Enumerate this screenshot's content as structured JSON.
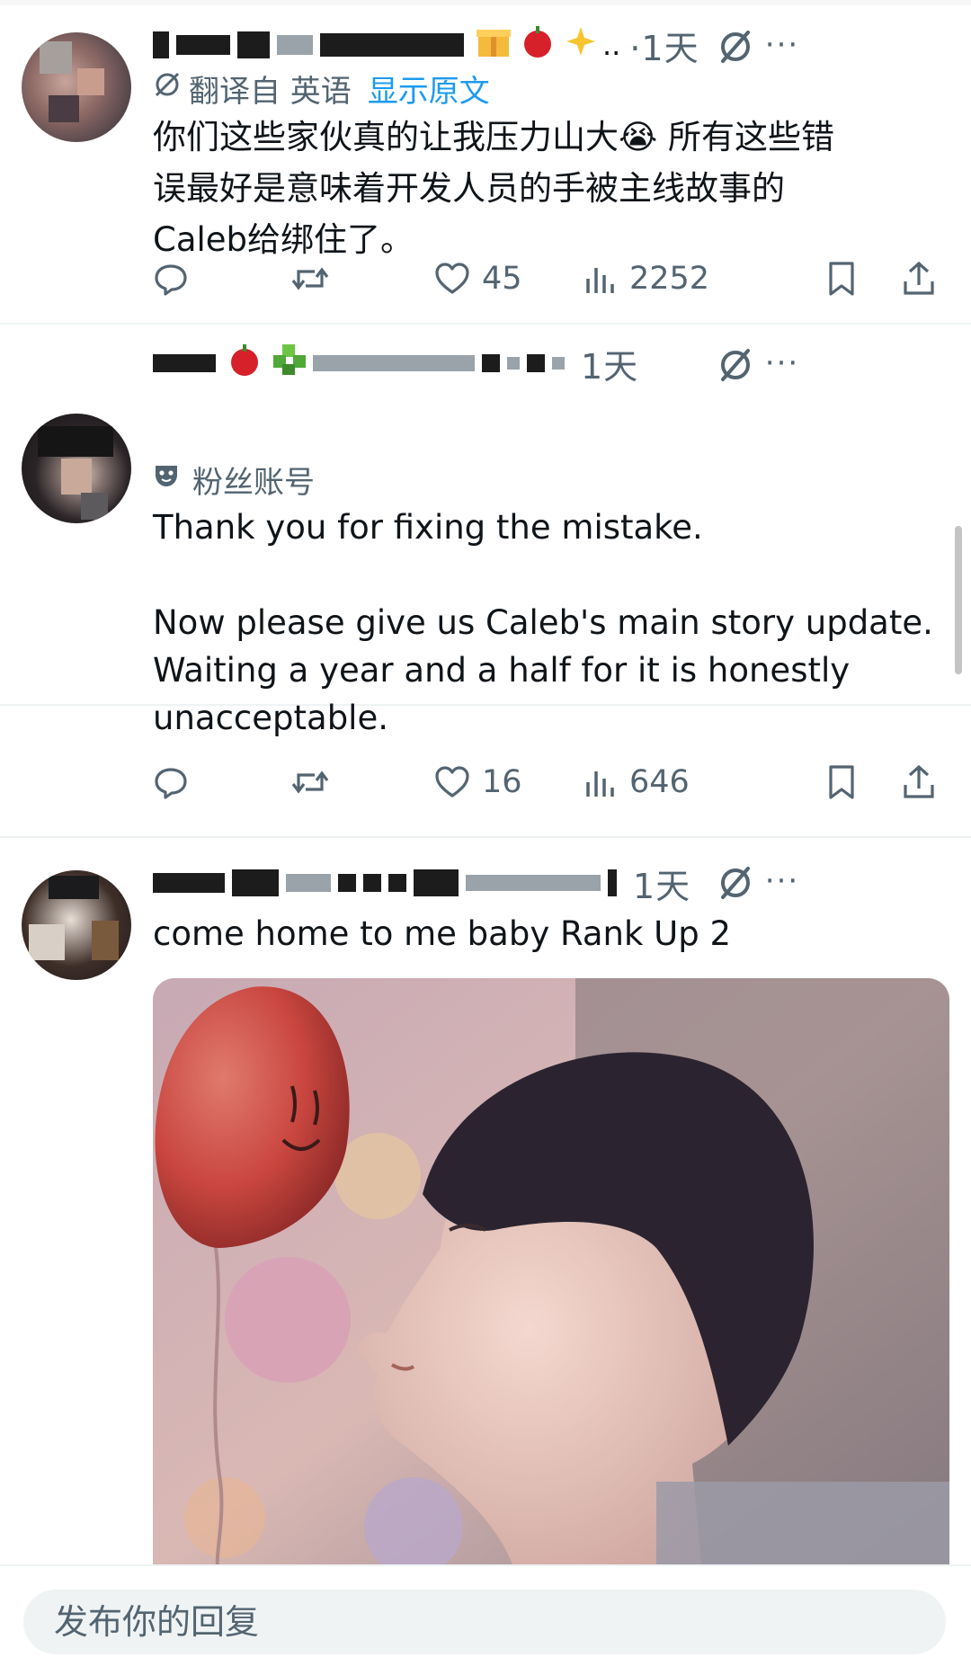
{
  "posts": [
    {
      "time": "·1天",
      "translated_from": "翻译自 英语",
      "show_original": "显示原文",
      "text": "你们这些家伙真的让我压力山大😭 所有这些错\n误最好是意味着开发人员的手被主线故事的\nCaleb给绑住了。",
      "likes": "45",
      "views": "2252"
    },
    {
      "time": "1天",
      "account_label": "粉丝账号",
      "text": "Thank you for fixing the mistake.\n\nNow please give us Caleb's main story update.\nWaiting a year and a half for it is honestly\nunacceptable.",
      "likes": "16",
      "views": "646"
    },
    {
      "time": "1天",
      "text": "come home to me baby Rank Up 2"
    }
  ],
  "reply": {
    "placeholder": "发布你的回复"
  },
  "icons": {
    "reply": "reply-icon",
    "repost": "repost-icon",
    "like": "heart-icon",
    "views": "views-icon",
    "bookmark": "bookmark-icon",
    "share": "share-icon",
    "grok": "grok-icon",
    "more": "more-icon"
  },
  "colors": {
    "secondary_text": "#536471",
    "link": "#1d9bf0",
    "primary_text": "#0f1419"
  }
}
